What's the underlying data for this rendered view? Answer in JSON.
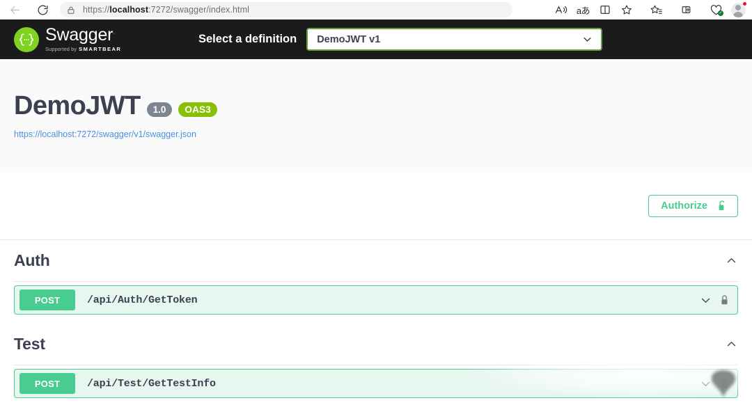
{
  "browser": {
    "back_icon": "back-arrow-icon",
    "reload_icon": "reload-icon",
    "site_lock_icon": "site-info-lock-icon",
    "url_prefix": "https://",
    "url_host": "localhost",
    "url_rest": ":7272/swagger/index.html",
    "url_full": "https://localhost:7272/swagger/index.html",
    "toolbar": [
      {
        "name": "read-aloud-icon",
        "glyph": "A"
      },
      {
        "name": "translate-icon",
        "glyph": "aあ"
      },
      {
        "name": "split-screen-icon",
        "glyph": "▯"
      },
      {
        "name": "favorite-star-icon",
        "glyph": "☆"
      },
      {
        "name": "collections-icon",
        "glyph": "☆"
      },
      {
        "name": "add-to-tabs-icon",
        "glyph": "⊞"
      },
      {
        "name": "browser-essentials-icon",
        "glyph": "♡"
      }
    ],
    "profile": {
      "name": "profile-avatar",
      "notification": true
    }
  },
  "topbar": {
    "logo_word": "Swagger",
    "logo_tm": ".",
    "logo_supported_prefix": "Supported by",
    "logo_supported_brand": "SMARTBEAR",
    "definition_label": "Select a definition",
    "definition_selected": "DemoJWT v1",
    "definition_options": [
      "DemoJWT v1"
    ]
  },
  "info": {
    "title": "DemoJWT",
    "version_badge": "1.0",
    "oas_badge": "OAS3",
    "url": "https://localhost:7272/swagger/v1/swagger.json"
  },
  "scheme": {
    "authorize_label": "Authorize",
    "authorize_icon": "unlock-icon"
  },
  "tags": [
    {
      "name": "Auth",
      "expanded": true,
      "toggle_icon": "chevron-up-icon",
      "operations": [
        {
          "method": "POST",
          "path": "/api/Auth/GetToken",
          "expand_icon": "chevron-down-icon",
          "auth_icon": "lock-icon",
          "secured": true
        }
      ]
    },
    {
      "name": "Test",
      "expanded": true,
      "toggle_icon": "chevron-up-icon",
      "operations": [
        {
          "method": "POST",
          "path": "/api/Test/GetTestInfo",
          "expand_icon": "chevron-down-icon",
          "auth_icon": "lock-icon",
          "secured": true
        }
      ]
    }
  ],
  "colors": {
    "topbar_bg": "#1b1b1b",
    "swagger_green": "#49cc90",
    "logo_green": "#7ed321",
    "oas_green": "#89bf04",
    "version_gray": "#7d8492",
    "text_dark": "#3b4151",
    "link_blue": "#4990e2",
    "select_border": "#62a03f",
    "op_bg": "#e8f6f0"
  }
}
